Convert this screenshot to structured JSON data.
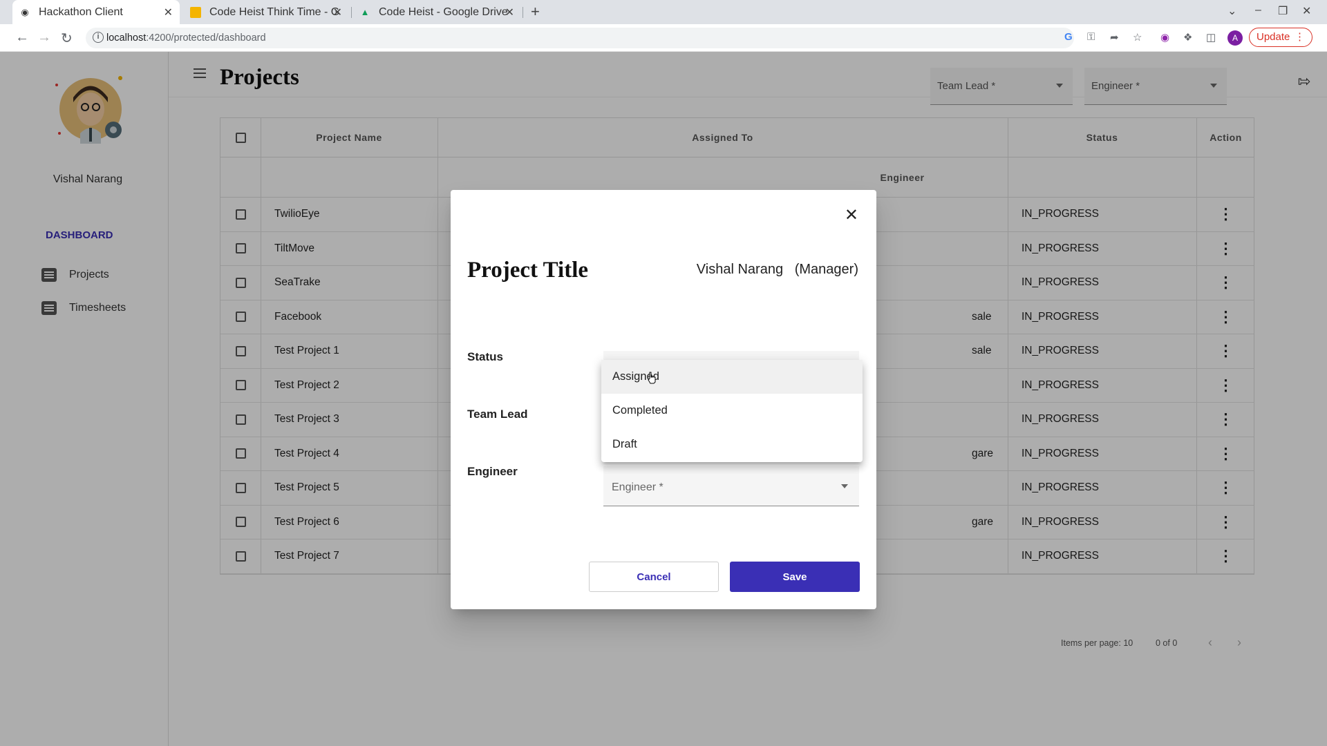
{
  "browser": {
    "tabs": [
      {
        "title": "Hackathon Client",
        "active": true
      },
      {
        "title": "Code Heist Think Time - G"
      },
      {
        "title": "Code Heist - Google Drive"
      }
    ],
    "url_host": "localhost",
    "url_path": ":4200/protected/dashboard",
    "update_label": "Update"
  },
  "sidebar": {
    "username": "Vishal Narang",
    "section": "DASHBOARD",
    "items": [
      {
        "label": "Projects"
      },
      {
        "label": "Timesheets"
      }
    ]
  },
  "page": {
    "title": "Projects",
    "filters": {
      "team_lead": "Team Lead *",
      "engineer": "Engineer *"
    }
  },
  "table": {
    "headers": {
      "project_name": "Project Name",
      "assigned_to": "Assigned To",
      "status": "Status",
      "action": "Action",
      "engineer": "Engineer"
    },
    "rows": [
      {
        "name": "TwilioEye",
        "engineer": "",
        "status": "IN_PROGRESS"
      },
      {
        "name": "TiltMove",
        "engineer": "",
        "status": "IN_PROGRESS"
      },
      {
        "name": "SeaTrake",
        "engineer": "",
        "status": "IN_PROGRESS"
      },
      {
        "name": "Facebook",
        "engineer": "sale",
        "status": "IN_PROGRESS"
      },
      {
        "name": "Test Project 1",
        "engineer": "sale",
        "status": "IN_PROGRESS"
      },
      {
        "name": "Test Project 2",
        "engineer": "",
        "status": "IN_PROGRESS"
      },
      {
        "name": "Test Project 3",
        "engineer": "",
        "status": "IN_PROGRESS"
      },
      {
        "name": "Test Project 4",
        "engineer": "gare",
        "status": "IN_PROGRESS"
      },
      {
        "name": "Test Project 5",
        "engineer": "",
        "status": "IN_PROGRESS"
      },
      {
        "name": "Test Project 6",
        "engineer": "gare",
        "status": "IN_PROGRESS"
      },
      {
        "name": "Test Project 7",
        "engineer": "",
        "status": "IN_PROGRESS"
      }
    ],
    "paginator": {
      "items_per_page": "Items per page: 10",
      "range": "0 of 0"
    }
  },
  "dialog": {
    "title": "Project Title",
    "manager": "Vishal Narang   (Manager)",
    "labels": {
      "status": "Status",
      "team_lead": "Team Lead",
      "engineer": "Engineer"
    },
    "engineer_placeholder": "Engineer *",
    "status_options": [
      "Assigned",
      "Completed",
      "Draft"
    ],
    "cancel_label": "Cancel",
    "save_label": "Save"
  },
  "colors": {
    "accent": "#3a2fb5",
    "error": "#e53935"
  }
}
